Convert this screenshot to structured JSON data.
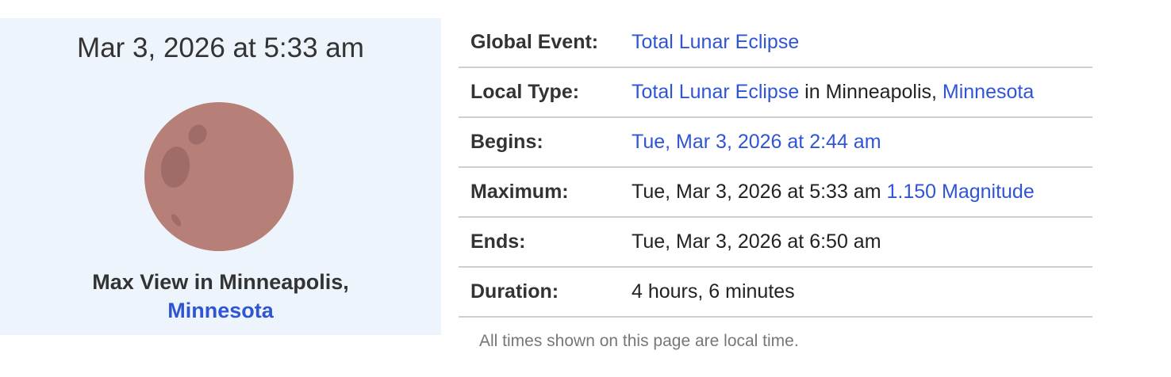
{
  "card": {
    "date": "Mar 3, 2026 at 5:33 am",
    "moon_color": "#b67f78",
    "caption_prefix": "Max View in Minneapolis,",
    "caption_link": "Minnesota"
  },
  "table": {
    "global_event": {
      "label": "Global Event:",
      "value_link": "Total Lunar Eclipse"
    },
    "local_type": {
      "label": "Local Type:",
      "value_link": "Total Lunar Eclipse",
      "value_text": " in Minneapolis, ",
      "value_link2": "Minnesota"
    },
    "begins": {
      "label": "Begins:",
      "value_link": "Tue, Mar 3, 2026 at 2:44 am"
    },
    "maximum": {
      "label": "Maximum:",
      "value_text": "Tue, Mar 3, 2026 at 5:33 am ",
      "value_link": "1.150 Magnitude"
    },
    "ends": {
      "label": "Ends:",
      "value_text": "Tue, Mar 3, 2026 at 6:50 am"
    },
    "duration": {
      "label": "Duration:",
      "value_text": "4 hours, 6 minutes"
    }
  },
  "note": "All times shown on this page are local time.",
  "colors": {
    "link": "#2f55d4",
    "card_bg": "#eef4fc",
    "divider": "#cfcfcf"
  }
}
